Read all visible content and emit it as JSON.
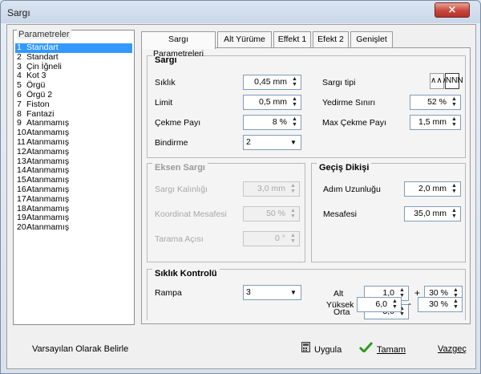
{
  "window": {
    "title": "Sargı",
    "close_glyph": "×"
  },
  "parameters": {
    "legend": "Parametreler",
    "items": [
      {
        "num": "1",
        "label": "Standart",
        "selected": true
      },
      {
        "num": "2",
        "label": "Standart"
      },
      {
        "num": "3",
        "label": "Çin İğneli"
      },
      {
        "num": "4",
        "label": "Kot 3"
      },
      {
        "num": "5",
        "label": "Örgü"
      },
      {
        "num": "6",
        "label": "Örgü 2"
      },
      {
        "num": "7",
        "label": "Fiston"
      },
      {
        "num": "8",
        "label": "Fantazi"
      },
      {
        "num": "9",
        "label": "Atanmamış"
      },
      {
        "num": "10",
        "label": "Atanmamış"
      },
      {
        "num": "11",
        "label": "Atanmamış"
      },
      {
        "num": "12",
        "label": "Atanmamış"
      },
      {
        "num": "13",
        "label": "Atanmamış"
      },
      {
        "num": "14",
        "label": "Atanmamış"
      },
      {
        "num": "15",
        "label": "Atanmamış"
      },
      {
        "num": "16",
        "label": "Atanmamış"
      },
      {
        "num": "17",
        "label": "Atanmamış"
      },
      {
        "num": "18",
        "label": "Atanmamış"
      },
      {
        "num": "19",
        "label": "Atanmamış"
      },
      {
        "num": "20",
        "label": "Atanmamış"
      }
    ]
  },
  "tabs": [
    "Sargı Parametreleri",
    "Alt Yürüme",
    "Effekt 1",
    "Efekt 2",
    "Genişlet"
  ],
  "sargi": {
    "title": "Sargı",
    "siklik_label": "Sıklık",
    "siklik_value": "0,45 mm",
    "limit_label": "Limit",
    "limit_value": "0,5 mm",
    "cekme_label": "Çekme Payı",
    "cekme_value": "8 %",
    "bindirme_label": "Bindirme",
    "bindirme_value": "2",
    "tipi_label": "Sargı tipi",
    "tipi_icon_1": "∧∧∧",
    "tipi_icon_2": "NNN",
    "yedirme_label": "Yedirme Sınırı",
    "yedirme_value": "52 %",
    "maxcekme_label": "Max Çekme Payı",
    "maxcekme_value": "1,5 mm"
  },
  "eksen": {
    "title": "Eksen Sargı",
    "kalinlik_label": "Sargı Kalınlığı",
    "kalinlik_value": "3,0 mm",
    "koordinat_label": "Koordinat Mesafesi",
    "koordinat_value": "50 %",
    "tarama_label": "Tarama Açısı",
    "tarama_value": "0 °"
  },
  "gecis": {
    "title": "Geçiş Dikişi",
    "adim_label": "Adım Uzunluğu",
    "adim_value": "2,0 mm",
    "mesafe_label": "Mesafesi",
    "mesafe_value": "35,0 mm"
  },
  "siklik_kontrol": {
    "title": "Sıklık Kontrolü",
    "rampa_label": "Rampa",
    "rampa_value": "3",
    "alt_label": "Alt",
    "alt_value": "1,0",
    "alt_pct": "30 %",
    "alt_op": "+",
    "orta_label": "Orta",
    "orta_value": "3,0",
    "yuksek_label": "Yüksek",
    "yuksek_value": "6,0",
    "yuksek_pct": "30 %",
    "yuksek_op": "-"
  },
  "footer": {
    "default_label": "Varsayılan Olarak Belirle",
    "apply_label": "Uygula",
    "ok_label": "Tamam",
    "cancel_label": "Vazgeç"
  }
}
